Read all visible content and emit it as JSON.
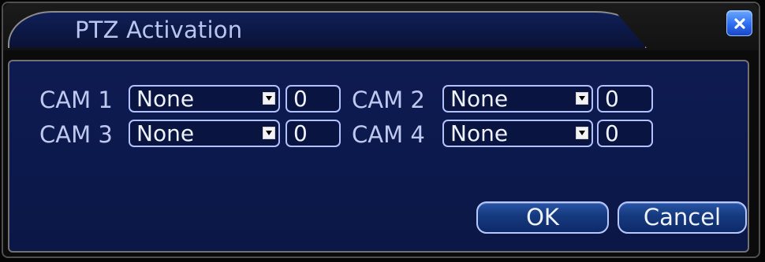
{
  "dialog": {
    "title": "PTZ Activation",
    "close_icon": "close-icon"
  },
  "cams": [
    {
      "label": "CAM 1",
      "mode": "None",
      "value": "0"
    },
    {
      "label": "CAM 2",
      "mode": "None",
      "value": "0"
    },
    {
      "label": "CAM 3",
      "mode": "None",
      "value": "0"
    },
    {
      "label": "CAM 4",
      "mode": "None",
      "value": "0"
    }
  ],
  "buttons": {
    "ok": "OK",
    "cancel": "Cancel"
  }
}
